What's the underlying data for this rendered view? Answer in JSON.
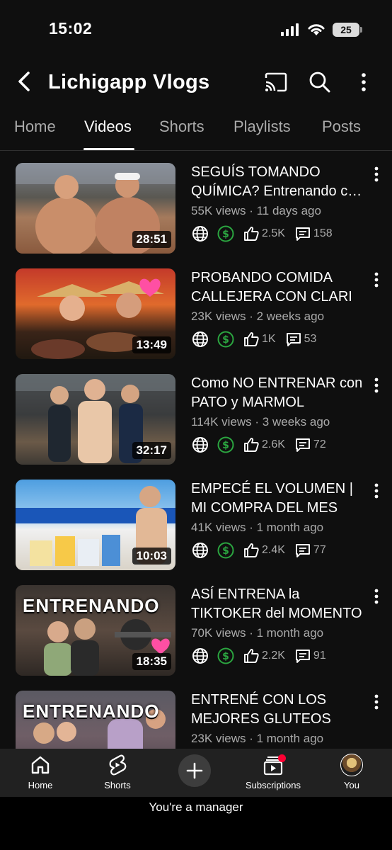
{
  "status_bar": {
    "time": "15:02",
    "battery": "25"
  },
  "header": {
    "title": "Lichigapp Vlogs"
  },
  "tabs": [
    {
      "label": "Home"
    },
    {
      "label": "Videos"
    },
    {
      "label": "Shorts"
    },
    {
      "label": "Playlists"
    },
    {
      "label": "Posts"
    }
  ],
  "active_tab": "Videos",
  "videos": [
    {
      "title": "SEGUÍS TOMANDO QUÍMICA? Entrenando con Tomas Holder",
      "views": "55K views",
      "age": "11 days ago",
      "likes": "2.5K",
      "comments": "158",
      "duration": "28:51",
      "thumb_text": ""
    },
    {
      "title": "PROBANDO COMIDA CALLEJERA CON CLARI",
      "views": "23K views",
      "age": "2 weeks ago",
      "likes": "1K",
      "comments": "53",
      "duration": "13:49",
      "thumb_text": ""
    },
    {
      "title": "Como NO ENTRENAR con PATO y MARMOL",
      "views": "114K views",
      "age": "3 weeks ago",
      "likes": "2.6K",
      "comments": "72",
      "duration": "32:17",
      "thumb_text": ""
    },
    {
      "title": "EMPECÉ EL VOLUMEN | MI COMPRA DEL MES",
      "views": "41K views",
      "age": "1 month ago",
      "likes": "2.4K",
      "comments": "77",
      "duration": "10:03",
      "thumb_text": ""
    },
    {
      "title": "ASÍ ENTRENA la TIKTOKER del MOMENTO",
      "views": "70K views",
      "age": "1 month ago",
      "likes": "2.2K",
      "comments": "91",
      "duration": "18:35",
      "thumb_text": "ENTRENANDO"
    },
    {
      "title": "ENTRENÉ CON LOS MEJORES GLUTEOS",
      "views": "23K views",
      "age": "1 month ago",
      "likes": "",
      "comments": "",
      "duration": "",
      "thumb_text": "ENTRENANDO"
    }
  ],
  "bottom_nav": [
    {
      "label": "Home"
    },
    {
      "label": "Shorts"
    },
    {
      "label": "Subscriptions"
    },
    {
      "label": "You"
    }
  ],
  "footer": {
    "text": "You're a manager"
  },
  "colors": {
    "background": "#0f0f0f",
    "nav_background": "#212121",
    "secondary_text": "#aaaaaa",
    "monetization_green": "#2ba640",
    "notification_red": "#ff0033"
  },
  "icons": [
    "back-arrow",
    "cast",
    "search",
    "more-vertical",
    "globe",
    "dollar",
    "thumb-up",
    "comment",
    "home",
    "shorts",
    "plus",
    "subscriptions",
    "avatar"
  ]
}
